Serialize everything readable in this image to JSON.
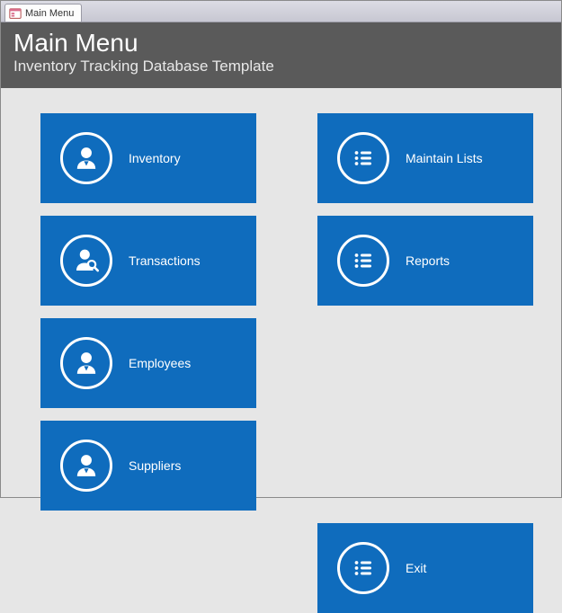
{
  "tab": {
    "label": "Main Menu"
  },
  "header": {
    "title": "Main Menu",
    "subtitle": "Inventory Tracking Database Template"
  },
  "tiles": {
    "inventory": "Inventory",
    "transactions": "Transactions",
    "employees": "Employees",
    "suppliers": "Suppliers",
    "maintain_lists": "Maintain Lists",
    "reports": "Reports",
    "exit": "Exit"
  },
  "colors": {
    "tile_bg": "#0f6cbd",
    "header_bg": "#5a5a5a"
  }
}
